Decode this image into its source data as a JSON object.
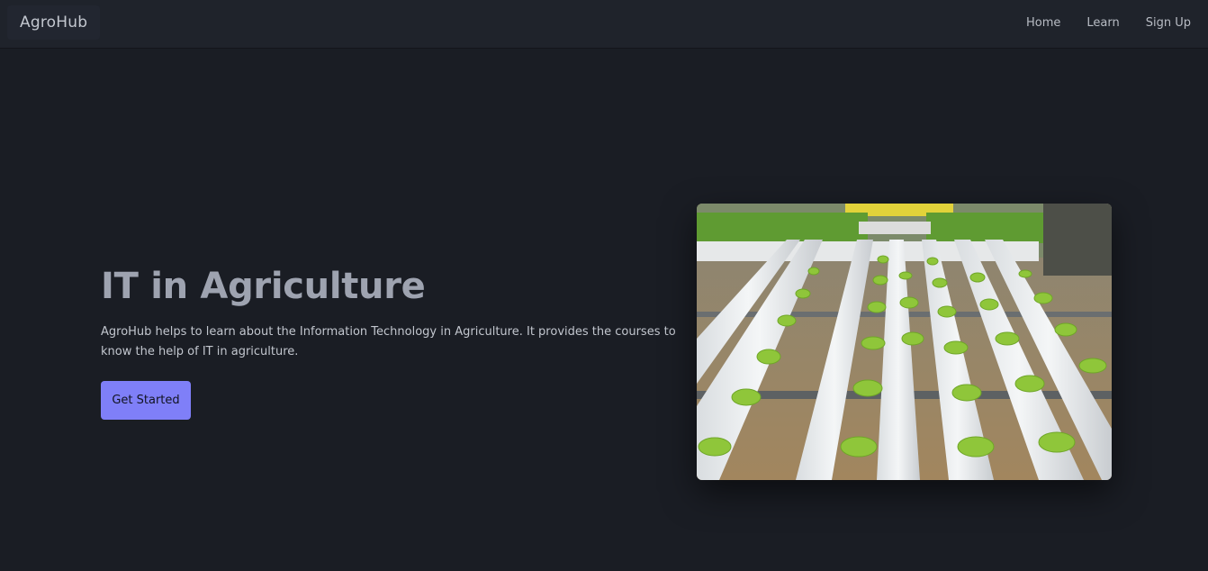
{
  "nav": {
    "brand": "AgroHub",
    "links": [
      "Home",
      "Learn",
      "Sign Up"
    ]
  },
  "hero": {
    "title": "IT in Agriculture",
    "description": "AgroHub helps to learn about the Information Technology in Agriculture. It provides the courses to know the help of IT in agriculture.",
    "cta_label": "Get Started",
    "image_alt": "hydroponic-lettuce-photo"
  },
  "colors": {
    "background": "#1a1d24",
    "navbar": "#1f232b",
    "accent": "#7f7ff8",
    "title": "#9ea3b0"
  }
}
